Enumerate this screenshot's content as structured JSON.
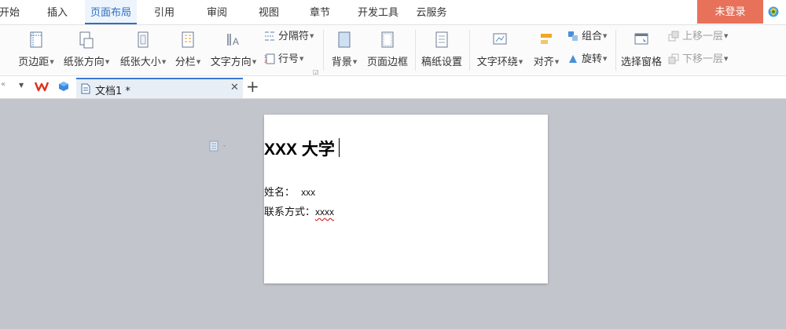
{
  "menu": {
    "tabs": [
      {
        "label": "开始"
      },
      {
        "label": "插入"
      },
      {
        "label": "页面布局"
      },
      {
        "label": "引用"
      },
      {
        "label": "审阅"
      },
      {
        "label": "视图"
      },
      {
        "label": "章节"
      },
      {
        "label": "开发工具"
      },
      {
        "label": "云服务"
      }
    ],
    "active_tab": "页面布局",
    "login": "未登录"
  },
  "ribbon": {
    "margins": "页边距",
    "orientation": "纸张方向",
    "size": "纸张大小",
    "columns": "分栏",
    "text_direction": "文字方向",
    "breaks": "分隔符",
    "line_numbers": "行号",
    "background": "背景",
    "page_border": "页面边框",
    "manuscript": "稿纸设置",
    "text_wrap": "文字环绕",
    "align": "对齐",
    "group": "组合",
    "rotate": "旋转",
    "selection_pane": "选择窗格",
    "bring_forward": "上移一层",
    "send_backward": "下移一层"
  },
  "tabs_bar": {
    "document_tab": "文档1 *"
  },
  "document": {
    "title": "XXX 大学",
    "name_label": "姓名：",
    "name_value": "xxx",
    "contact_label": "联系方式：",
    "contact_value": "xxxx"
  },
  "colors": {
    "accent": "#2b6fc7",
    "login_bg": "#e8715a",
    "workspace_bg": "#c2c5cc"
  }
}
